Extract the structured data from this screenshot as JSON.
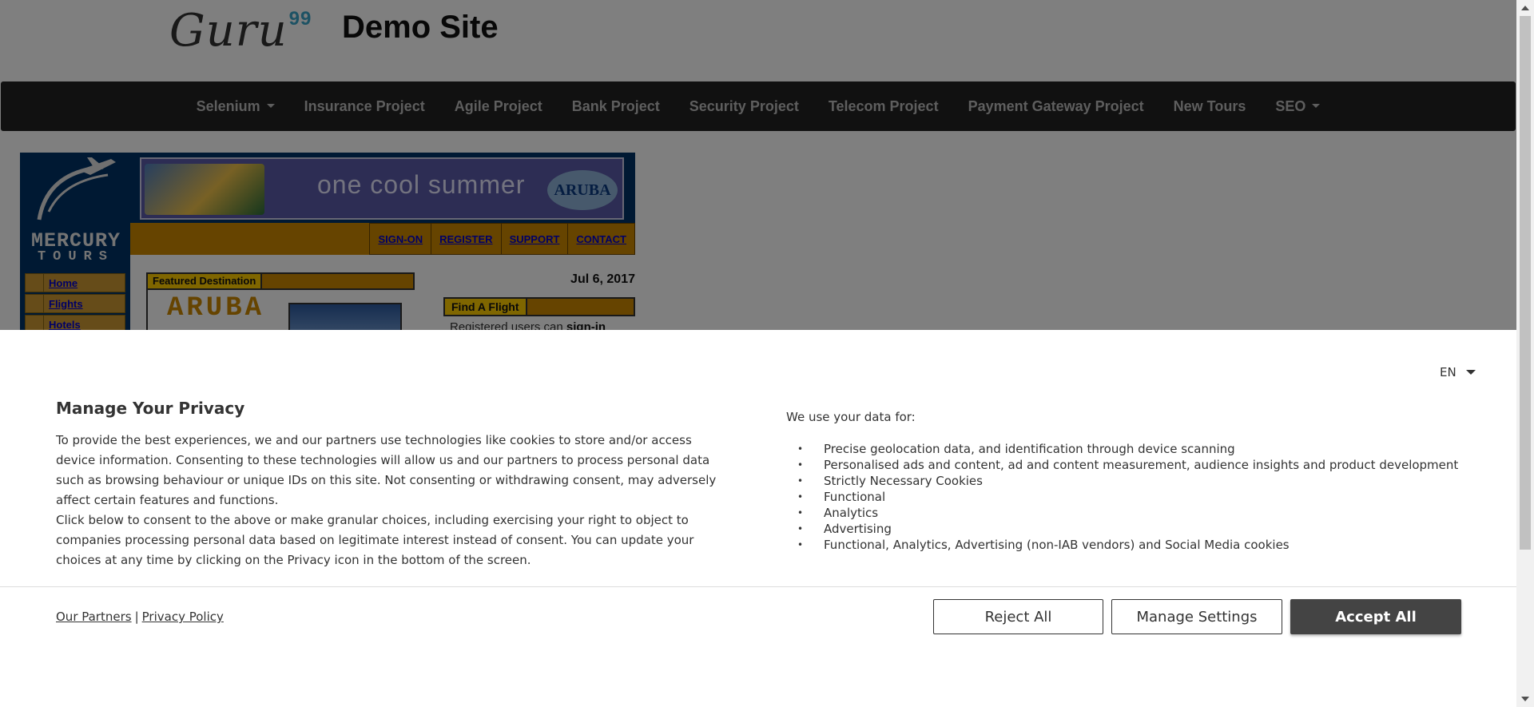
{
  "site": {
    "logo_text": "Guru",
    "logo_sup": "99",
    "title": "Demo Site"
  },
  "nav": {
    "items": [
      {
        "label": "Selenium",
        "dropdown": true
      },
      {
        "label": "Insurance Project",
        "dropdown": false
      },
      {
        "label": "Agile Project",
        "dropdown": false
      },
      {
        "label": "Bank Project",
        "dropdown": false
      },
      {
        "label": "Security Project",
        "dropdown": false
      },
      {
        "label": "Telecom Project",
        "dropdown": false
      },
      {
        "label": "Payment Gateway Project",
        "dropdown": false
      },
      {
        "label": "New Tours",
        "dropdown": false
      },
      {
        "label": "SEO",
        "dropdown": true
      }
    ]
  },
  "mercury": {
    "logo_line1": "MERCURY",
    "logo_line2": "TOURS",
    "banner_text": "one cool summer",
    "banner_brand": "ARUBA",
    "top_links": [
      "SIGN-ON",
      "REGISTER",
      "SUPPORT",
      "CONTACT"
    ],
    "menu": [
      "Home",
      "Flights",
      "Hotels"
    ],
    "featured_label": "Featured Destination",
    "featured_title": "ARUBA",
    "date": "Jul 6, 2017",
    "find_flight_label": "Find A Flight",
    "find_note_prefix": "Registered users can ",
    "find_note_bold": "sign-in"
  },
  "privacy": {
    "language": "EN",
    "title": "Manage Your Privacy",
    "paragraph1": "To provide the best experiences, we and our partners use technologies like cookies to store and/or access device information. Consenting to these technologies will allow us and our partners to process personal data such as browsing behaviour or unique IDs on this site. Not consenting or withdrawing consent, may adversely affect certain features and functions.",
    "paragraph2": "Click below to consent to the above or make granular choices, including exercising your right to object to companies processing personal data based on legitimate interest instead of consent. You can update your choices at any time by clicking on the Privacy icon in the bottom of the screen.",
    "uses_header": "We use your data for:",
    "uses": [
      "Precise geolocation data, and identification through device scanning",
      "Personalised ads and content, ad and content measurement, audience insights and product development",
      "Strictly Necessary Cookies",
      "Functional",
      "Analytics",
      "Advertising",
      "Functional, Analytics, Advertising (non-IAB vendors) and Social Media cookies"
    ],
    "our_partners": "Our Partners",
    "separator": "|",
    "privacy_policy": "Privacy Policy",
    "buttons": {
      "reject": "Reject All",
      "manage": "Manage Settings",
      "accept": "Accept All"
    }
  },
  "colors": {
    "navbar_bg": "#222222",
    "accept_bg": "#444444",
    "mercury_navy": "#003366",
    "mercury_orange": "#cc8800"
  }
}
